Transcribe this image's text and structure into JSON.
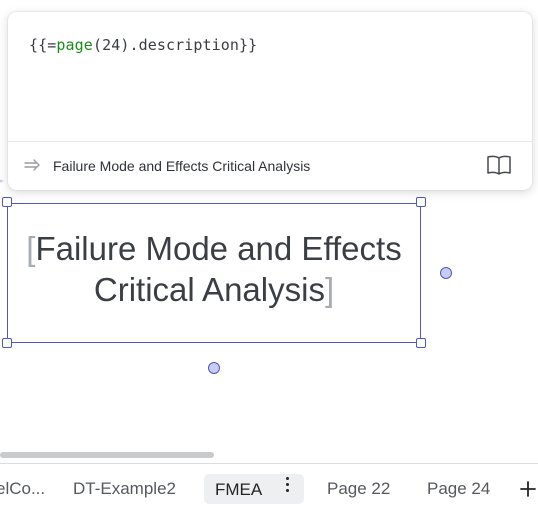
{
  "formula_popup": {
    "code_prefix": "{{=",
    "code_function": "page",
    "code_suffix": "(24).description}}",
    "result_text": "Failure Mode and Effects Critical Analysis",
    "icons": {
      "result": "arrow-right-icon",
      "docs": "book-icon"
    }
  },
  "shape": {
    "line1": "Failure Mode and Effects",
    "line2": "Critical Analysis",
    "open_bracket": "[",
    "close_bracket": "]"
  },
  "tabs": [
    {
      "label": "elCo..."
    },
    {
      "label": "DT-Example2"
    },
    {
      "label": "FMEA"
    },
    {
      "label": "Page 22"
    },
    {
      "label": "Page 24"
    }
  ],
  "active_tab": "FMEA",
  "colors": {
    "selection": "#5058b8",
    "handle_fill": "#c8cdf3",
    "function_name": "#1a8a1a",
    "text": "#3b3e44"
  }
}
